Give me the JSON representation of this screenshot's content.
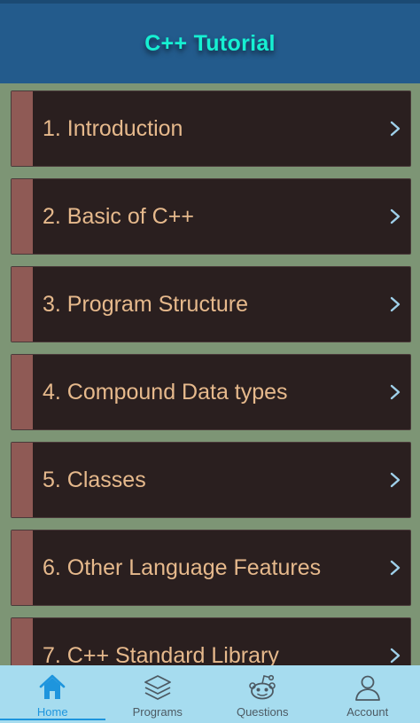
{
  "header": {
    "title": "C++ Tutorial"
  },
  "lessons": [
    {
      "label": "1. Introduction"
    },
    {
      "label": "2. Basic of C++"
    },
    {
      "label": "3. Program Structure"
    },
    {
      "label": "4. Compound Data types"
    },
    {
      "label": "5. Classes"
    },
    {
      "label": "6. Other Language Features"
    },
    {
      "label": "7. C++ Standard Library"
    }
  ],
  "bottom_nav": {
    "active": "Home",
    "tabs": [
      {
        "label": "Home",
        "icon": "home-icon"
      },
      {
        "label": "Programs",
        "icon": "layers-icon"
      },
      {
        "label": "Questions",
        "icon": "reddit-icon"
      },
      {
        "label": "Account",
        "icon": "user-icon"
      }
    ]
  },
  "colors": {
    "header": "#235b8c",
    "title": "#16f0d2",
    "background": "#7d9575",
    "item": "#2a1f1f",
    "stripe": "#8f5a55",
    "item_text": "#e6b98c",
    "chevron": "#9fd0ea",
    "nav": "#a6dcef",
    "nav_active": "#1e95dd"
  }
}
